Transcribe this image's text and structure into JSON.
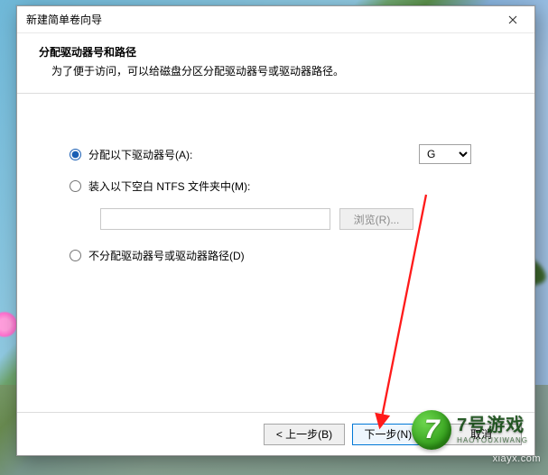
{
  "window": {
    "title": "新建简单卷向导",
    "close_icon_name": "close-icon"
  },
  "header": {
    "title": "分配驱动器号和路径",
    "subtitle": "为了便于访问，可以给磁盘分区分配驱动器号或驱动器路径。"
  },
  "options": {
    "assign": {
      "label": "分配以下驱动器号(A):",
      "selected_drive": "G"
    },
    "mount": {
      "label": "装入以下空白 NTFS 文件夹中(M):",
      "path_value": "",
      "browse_label": "浏览(R)..."
    },
    "none": {
      "label": "不分配驱动器号或驱动器路径(D)"
    },
    "selected": "assign"
  },
  "footer": {
    "back": "< 上一步(B)",
    "next": "下一步(N) >",
    "cancel": "取消"
  },
  "annotation": {
    "arrow_color": "#ff1a1a"
  },
  "watermark": {
    "badge_char": "7",
    "main": "7号游戏",
    "sub": "HAOYOUXIWANG",
    "url": "xiayx.com"
  }
}
